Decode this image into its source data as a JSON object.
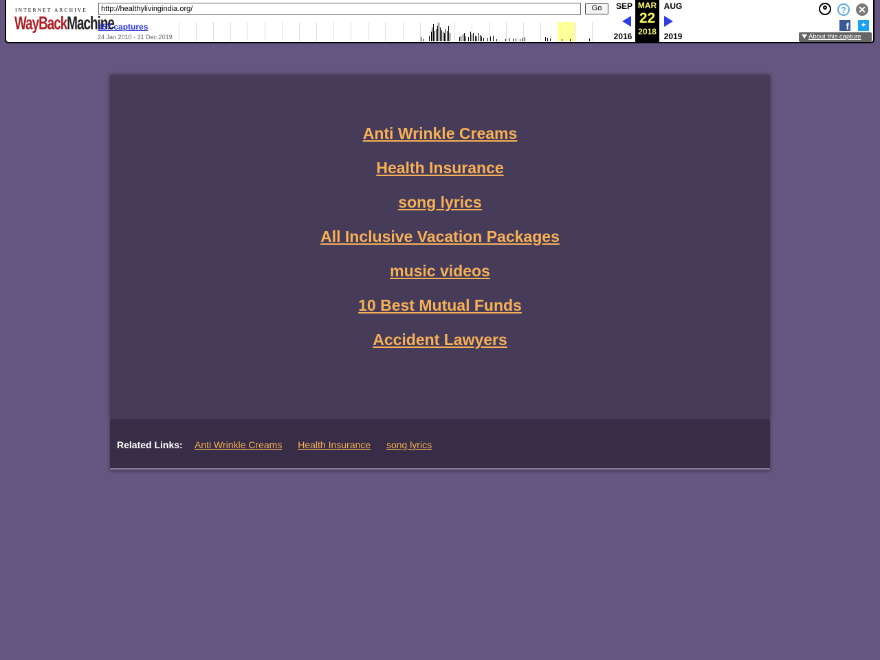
{
  "wayback": {
    "logo_top": "INTERNET ARCHIVE",
    "logo_part1": "WayBack",
    "logo_part2": "Machine",
    "url": "http://healthylivingindia.org/",
    "go_label": "Go",
    "captures": "157 captures",
    "range": "24 Jan 2010 - 31 Dec 2019",
    "prev_month": "SEP",
    "cur_month": "MAR",
    "next_month": "AUG",
    "prev_year": "2016",
    "cur_day": "22",
    "cur_year": "2018",
    "next_year": "2019",
    "about": "About this capture",
    "icons": [
      "user-icon",
      "help-icon",
      "close-icon",
      "facebook-icon",
      "twitter-icon"
    ]
  },
  "links": [
    "Anti Wrinkle Creams",
    "Health Insurance",
    "song lyrics",
    "All Inclusive Vacation Packages",
    "music videos",
    "10 Best Mutual Funds",
    "Accident Lawyers"
  ],
  "footer": {
    "label": "Related Links:",
    "links": [
      "Anti Wrinkle Creams",
      "Health Insurance",
      "song lyrics"
    ]
  },
  "colors": {
    "background": "#655681",
    "panel": "#463c5a",
    "footer": "#382d46",
    "link": "#f7b054"
  }
}
